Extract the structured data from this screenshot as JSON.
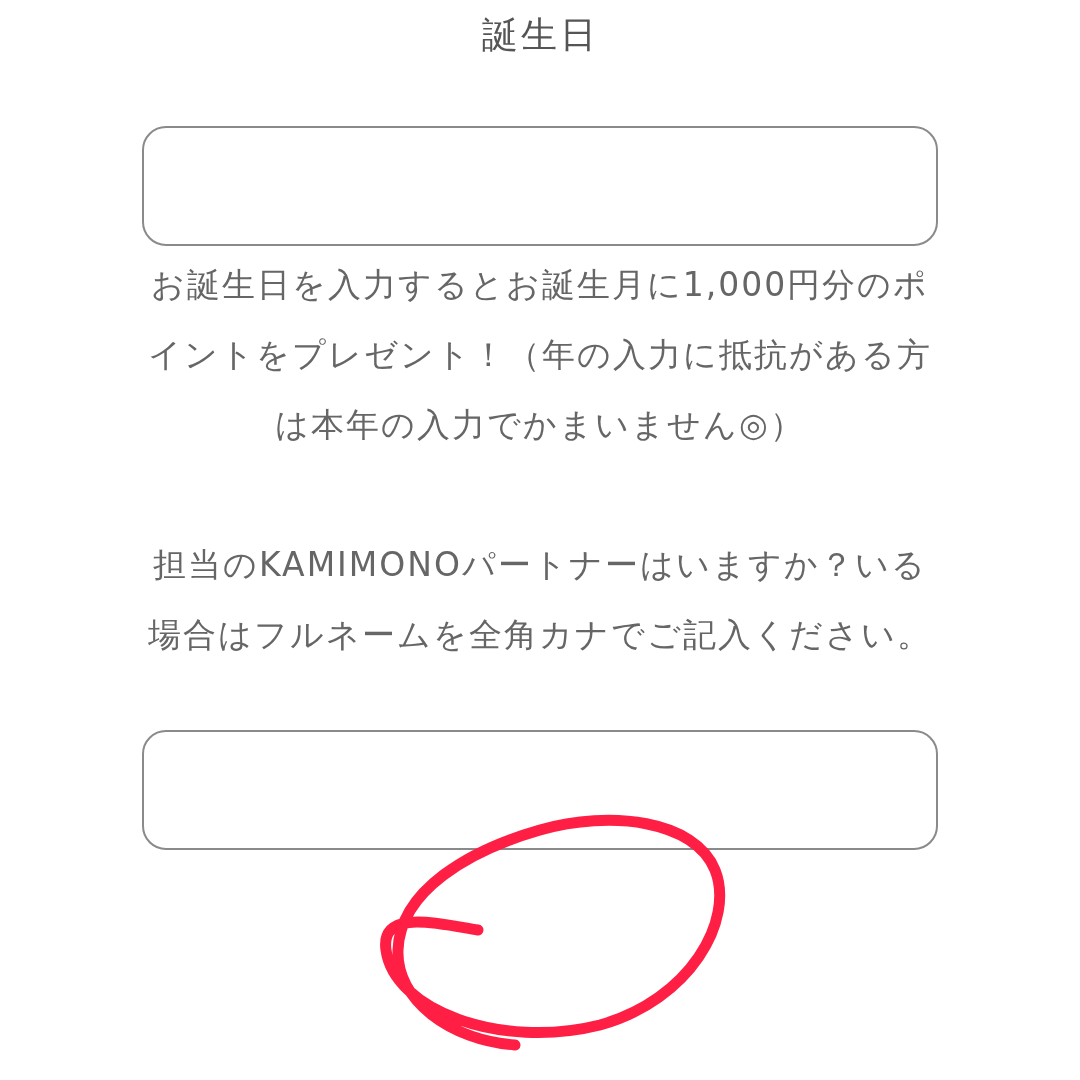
{
  "title": "誕生日",
  "birthday_note": "お誕生日を入力するとお誕生月に1,000円分のポイントをプレゼント！（年の入力に抵抗がある方は本年の入力でかまいません◎）",
  "partner_question": "担当のKAMIMONOパートナーはいますか？いる場合はフルネームを全角カナでご記入ください。"
}
